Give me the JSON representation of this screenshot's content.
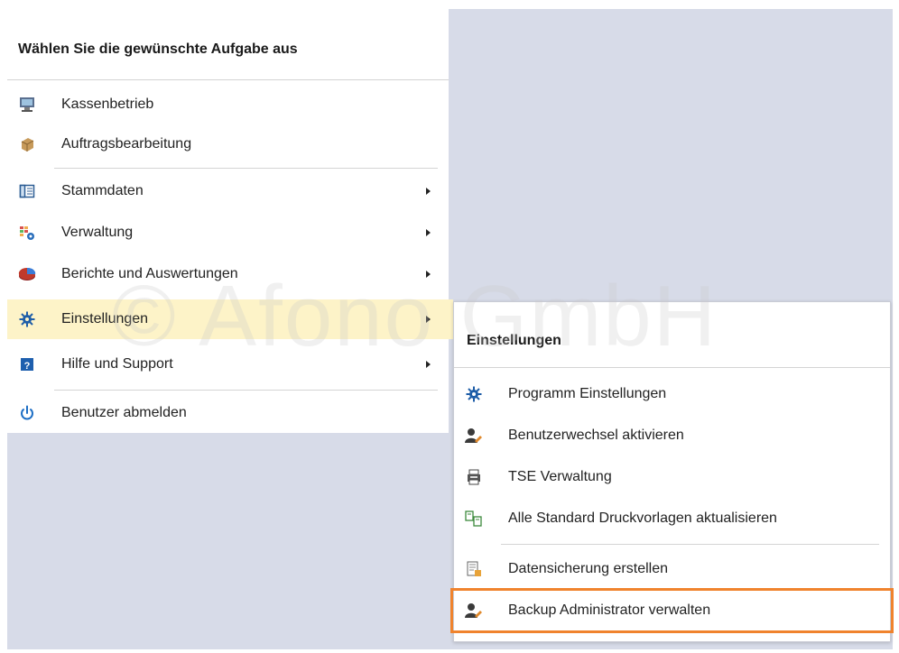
{
  "main_menu": {
    "header": "Wählen Sie die gewünschte Aufgabe aus",
    "items": [
      {
        "label": "Kassenbetrieb",
        "icon": "pos-terminal-icon"
      },
      {
        "label": "Auftragsbearbeitung",
        "icon": "order-processing-icon"
      },
      {
        "label": "Stammdaten",
        "icon": "master-data-icon",
        "submenu": true
      },
      {
        "label": "Verwaltung",
        "icon": "administration-icon",
        "submenu": true
      },
      {
        "label": "Berichte und Auswertungen",
        "icon": "reports-pie-icon",
        "submenu": true
      },
      {
        "label": "Einstellungen",
        "icon": "gear-icon",
        "submenu": true,
        "highlighted": true
      },
      {
        "label": "Hilfe und Support",
        "icon": "help-icon",
        "submenu": true
      },
      {
        "label": "Benutzer abmelden",
        "icon": "power-icon"
      }
    ]
  },
  "sub_menu": {
    "header": "Einstellungen",
    "items": [
      {
        "label": "Programm Einstellungen",
        "icon": "gear-icon"
      },
      {
        "label": "Benutzerwechsel aktivieren",
        "icon": "user-switch-icon"
      },
      {
        "label": "TSE Verwaltung",
        "icon": "tse-device-icon"
      },
      {
        "label": "Alle Standard Druckvorlagen aktualisieren",
        "icon": "print-templates-icon"
      },
      {
        "label": "Datensicherung erstellen",
        "icon": "backup-document-icon"
      },
      {
        "label": "Backup Administrator verwalten",
        "icon": "user-admin-icon",
        "boxed": true
      }
    ]
  },
  "watermark": "© Afono GmbH",
  "colors": {
    "highlight": "#fdf3c8",
    "desktop": "#d7dbe8",
    "callout_border": "#f0832d",
    "accent_blue": "#1e6fc5"
  }
}
